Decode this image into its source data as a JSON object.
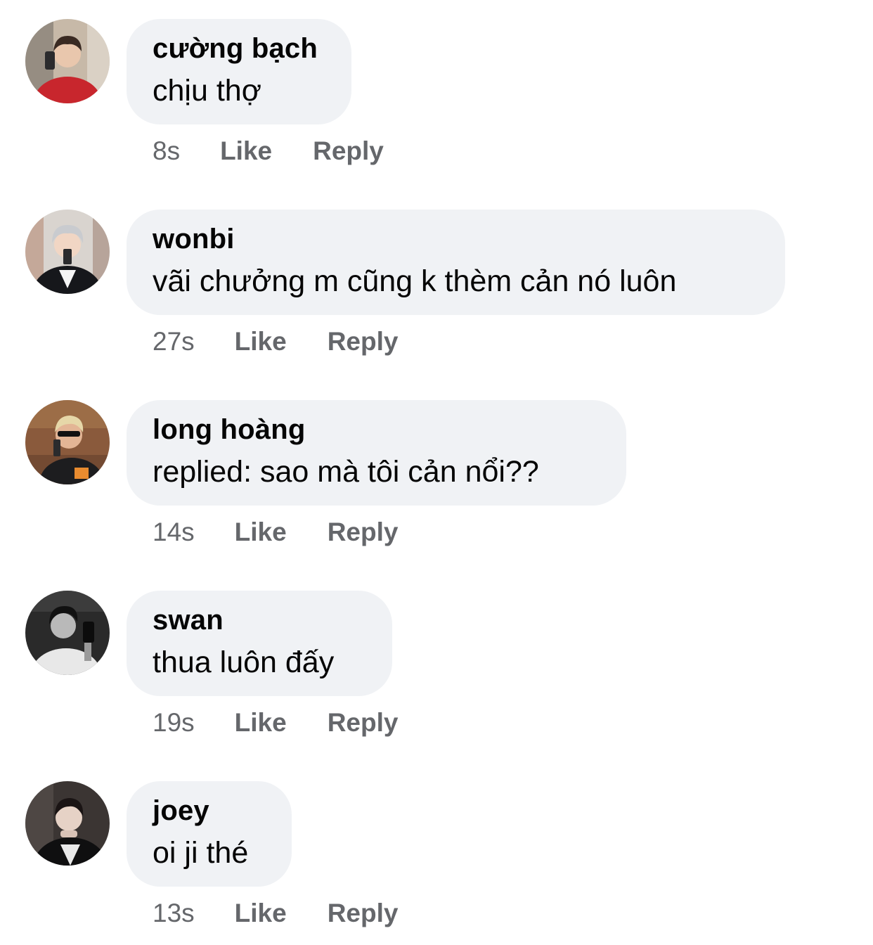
{
  "comments": [
    {
      "author": "cường bạch",
      "text": "chịu thợ",
      "time": "8s",
      "like_label": "Like",
      "reply_label": "Reply",
      "avatar": {
        "bg": "#c7b9a8",
        "shirt": "#c8262d",
        "hair": "#3a2a22",
        "skin": "#e9c7ad"
      }
    },
    {
      "author": "wonbi",
      "text": "vãi chưởng m cũng k thèm cản nó luôn",
      "time": "27s",
      "like_label": "Like",
      "reply_label": "Reply",
      "avatar": {
        "bg": "#d9d4cf",
        "shirt": "#16171b",
        "hair": "#c9cbcf",
        "skin": "#f1d6c4"
      }
    },
    {
      "author": "long hoàng",
      "text": "replied: sao mà tôi cản nổi??",
      "time": "14s",
      "like_label": "Like",
      "reply_label": "Reply",
      "avatar": {
        "bg": "#8a5a3c",
        "shirt": "#1d1d1f",
        "hair": "#e6d7a8",
        "skin": "#e3b595"
      }
    },
    {
      "author": "swan",
      "text": "thua luôn đấy",
      "time": "19s",
      "like_label": "Like",
      "reply_label": "Reply",
      "avatar": {
        "bg": "#2a2a2a",
        "shirt": "#e8e8e8",
        "hair": "#111111",
        "skin": "#b9b9b9"
      }
    },
    {
      "author": "joey",
      "text": "oi ji thé",
      "time": "13s",
      "like_label": "Like",
      "reply_label": "Reply",
      "avatar": {
        "bg": "#3b3533",
        "shirt": "#0f0f10",
        "hair": "#1a1414",
        "skin": "#e6d2c6"
      }
    }
  ],
  "colors": {
    "bubble": "#f0f2f5",
    "meta_text": "#65676b",
    "primary_text": "#050505"
  }
}
